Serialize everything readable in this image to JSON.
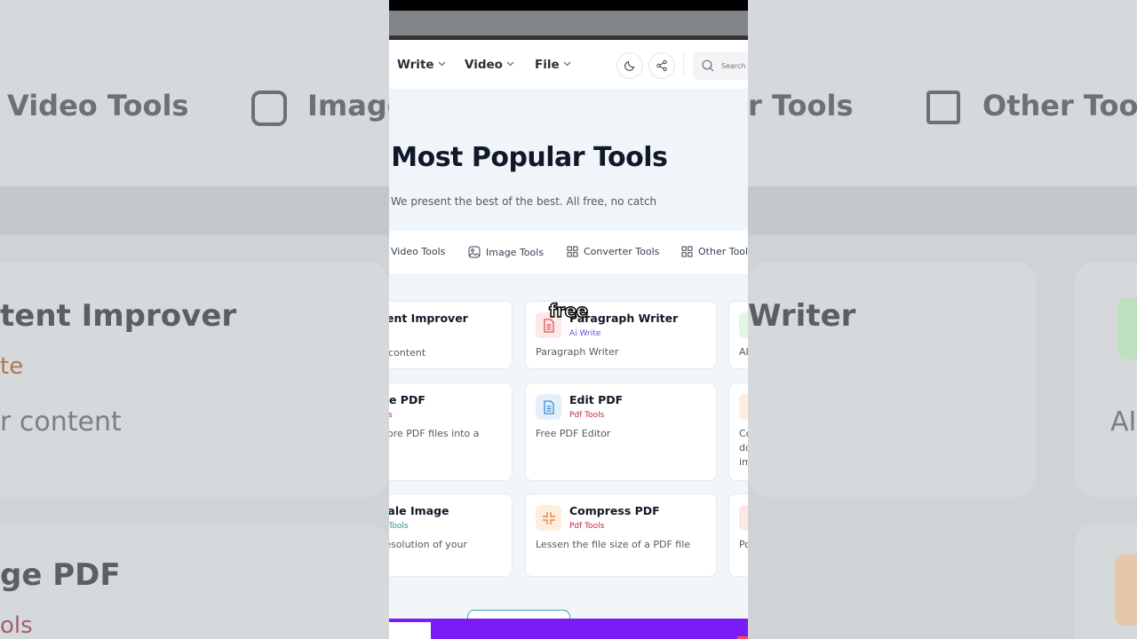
{
  "background": {
    "texts": [
      "Video Tools",
      "Image",
      "r Tools",
      "Other Tools",
      "tent Improver",
      "te",
      "r content",
      "Writer",
      "AI",
      "ge PDF",
      "ols"
    ]
  },
  "nav": {
    "items": [
      {
        "label": "Write"
      },
      {
        "label": "Video"
      },
      {
        "label": "File"
      }
    ],
    "search_placeholder": "Search"
  },
  "hero": {
    "title": "r Most Popular Tools",
    "subtitle": "We present the best of the best. All free, no catch"
  },
  "tabs": [
    {
      "label": "Video Tools",
      "icon": "video-icon"
    },
    {
      "label": "Image Tools",
      "icon": "image-icon"
    },
    {
      "label": "Converter Tools",
      "icon": "grid-icon"
    },
    {
      "label": "Other Tools",
      "icon": "grid-icon"
    }
  ],
  "cards": [
    {
      "title": "tent Improver",
      "category": "te",
      "category_color": "#e06a2a",
      "desc": "r content"
    },
    {
      "title": "Paragraph Writer",
      "category": "Ai Write",
      "category_color": "#6d4bd8",
      "desc": "Paragraph Writer",
      "icon": "document-icon",
      "icon_bg": "#fde8e8",
      "icon_color": "#e05252"
    },
    {
      "title": "",
      "category": "",
      "desc": "AI"
    },
    {
      "title": "ge PDF",
      "category": "ols",
      "category_color": "#c0264a",
      "desc1": "nore PDF files into a",
      "desc2": "e"
    },
    {
      "title": "Edit PDF",
      "category": "Pdf Tools",
      "category_color": "#c0264a",
      "desc": "Free PDF Editor",
      "icon": "document-icon",
      "icon_bg": "#e3f0fb",
      "icon_color": "#3a8ad6"
    },
    {
      "title": "",
      "category": "",
      "desc1": "Co",
      "desc2": "do",
      "desc3": "im"
    },
    {
      "title": "cale Image",
      "category": "e Tools",
      "category_color": "#2a8a8a",
      "desc": "resolution of your"
    },
    {
      "title": "Compress PDF",
      "category": "Pdf Tools",
      "category_color": "#c0264a",
      "desc": "Lessen the file size of a PDF file",
      "icon": "compress-icon",
      "icon_bg": "#fdeee0",
      "icon_color": "#e07a2a"
    },
    {
      "title": "",
      "category": "",
      "desc": "Po"
    }
  ],
  "caption": "free"
}
